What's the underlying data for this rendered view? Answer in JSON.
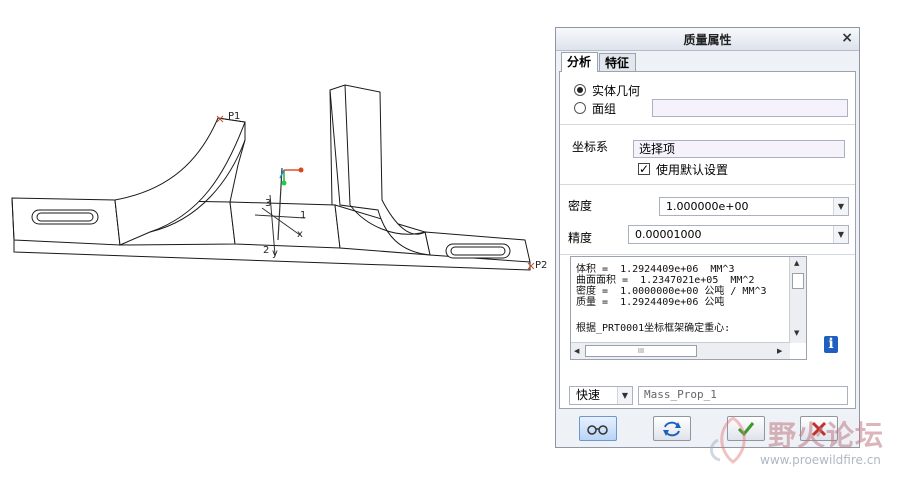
{
  "viewport": {
    "labels": {
      "p1": "P1",
      "p2": "P2",
      "axis_1": "1",
      "axis_2": "2",
      "axis_3": "3",
      "axis_y": "y",
      "axis_x": "x"
    }
  },
  "dialog": {
    "title": "质量属性",
    "close_glyph": "×",
    "tabs": [
      {
        "label": "分析"
      },
      {
        "label": "特征"
      }
    ],
    "geometry": {
      "solid_label": "实体几何",
      "quilt_label": "面组",
      "quilt_value": "",
      "selected": "solid"
    },
    "csys": {
      "label": "坐标系",
      "select_value": "选择项",
      "use_default_label": "使用默认设置",
      "use_default_checked": true,
      "check_glyph": "✓"
    },
    "density": {
      "label": "密度",
      "value": "1.000000e+00"
    },
    "accuracy": {
      "label": "精度",
      "value": "0.00001000"
    },
    "results": {
      "lines": [
        "体积 =  1.2924409e+06  MM^3",
        "曲面面积 =  1.2347021e+05  MM^2",
        "密度 =  1.0000000e+00 公吨 / MM^3",
        "质量 =  1.2924409e+06 公吨",
        "",
        "根据_PRT0001坐标框架确定重心:"
      ],
      "hscroll_grip": "III"
    },
    "mode": {
      "value": "快速"
    },
    "name_field": {
      "value": "Mass_Prop_1"
    },
    "toolbar": {
      "preview": "glasses-icon",
      "repeat": "refresh-icon",
      "ok": "check-icon",
      "cancel": "x-icon"
    }
  },
  "watermark": {
    "brand": "野火论坛",
    "url": "www.proewildfire.cn"
  },
  "colors": {
    "accent": "#1f5fbf",
    "dialog_bg": "#eef1f6",
    "ok_green": "#3a9a2a",
    "cancel_red": "#c0312a"
  }
}
